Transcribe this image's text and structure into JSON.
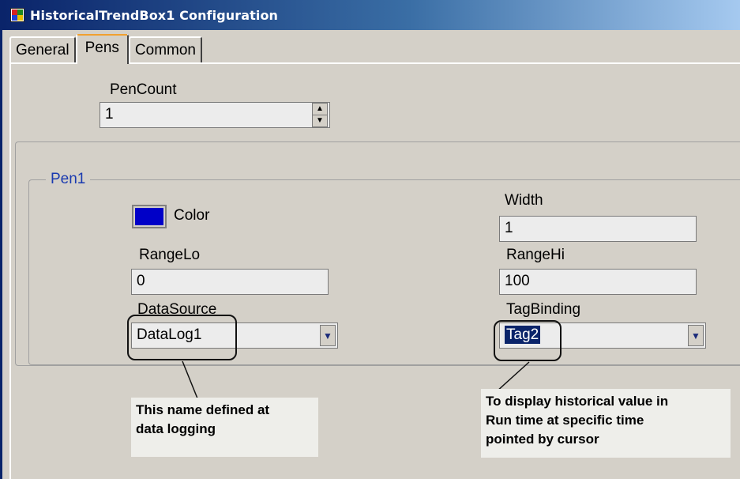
{
  "window": {
    "title": "HistoricalTrendBox1 Configuration",
    "app_icon": "configuration-app-icon"
  },
  "tabs": [
    {
      "label": "General"
    },
    {
      "label": "Pens",
      "active": true
    },
    {
      "label": "Common"
    }
  ],
  "pen_count": {
    "label": "PenCount",
    "value": "1",
    "spin_up": "▲",
    "spin_down": "▼"
  },
  "pen1": {
    "group_label": "Pen1",
    "color": {
      "label": "Color",
      "value": "#0000c8"
    },
    "width": {
      "label": "Width",
      "value": "1"
    },
    "range_lo": {
      "label": "RangeLo",
      "value": "0"
    },
    "range_hi": {
      "label": "RangeHi",
      "value": "100"
    },
    "data_source": {
      "label": "DataSource",
      "value": "DataLog1",
      "arrow": "▼"
    },
    "tag_binding": {
      "label": "TagBinding",
      "value": "Tag2",
      "arrow": "▼"
    }
  },
  "annotations": {
    "data_source_note": [
      "This name defined at",
      "data logging"
    ],
    "tag_binding_note": [
      "To display historical value in",
      "Run time at specific time",
      "pointed by cursor"
    ]
  },
  "colors": {
    "title_gradient_start": "#0a246a",
    "title_gradient_end": "#a6caf0",
    "group_label": "#1a3ab0",
    "selection": "#0a246a",
    "dialog_bg": "#d4d0c8"
  }
}
